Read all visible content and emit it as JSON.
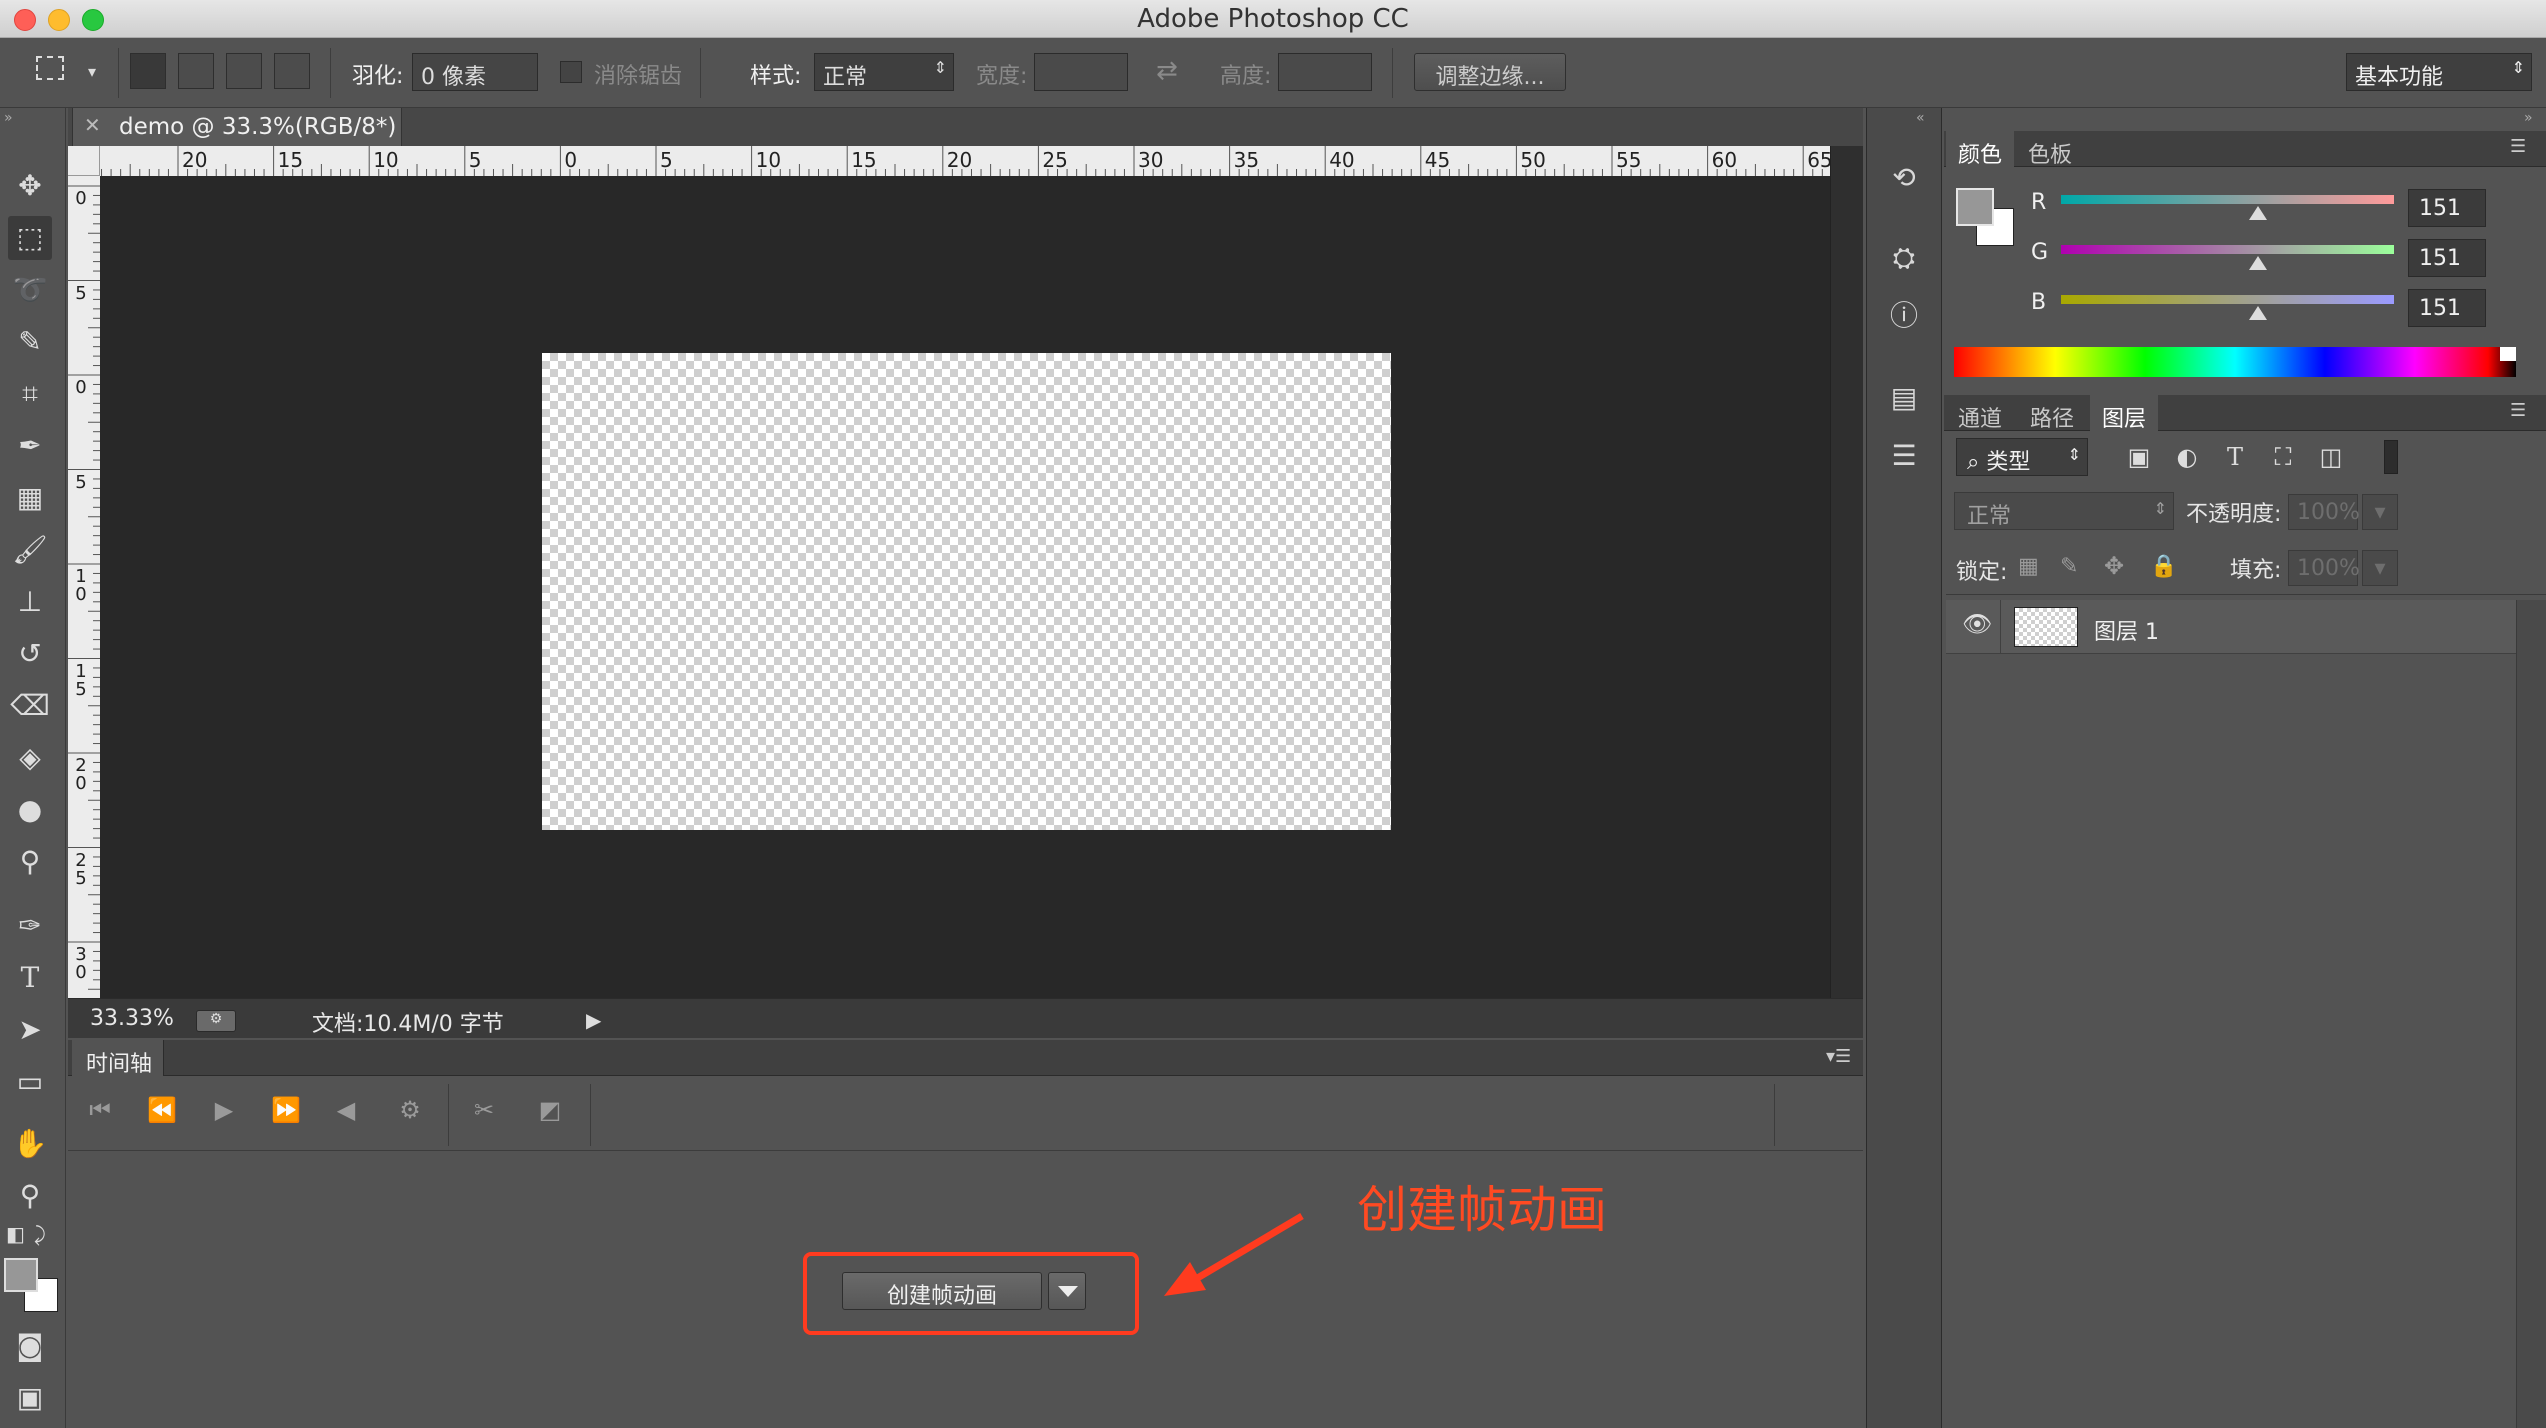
{
  "window": {
    "title": "Adobe Photoshop CC"
  },
  "options_bar": {
    "feather_label": "羽化:",
    "feather_value": "0 像素",
    "antialias_label": "消除锯齿",
    "style_label": "样式:",
    "style_value": "正常",
    "width_label": "宽度:",
    "height_label": "高度:",
    "refine_edge_button": "调整边缘...",
    "workspace_value": "基本功能"
  },
  "document": {
    "tab_title": "demo @ 33.3%(RGB/8*)",
    "hruler_labels": [
      "20",
      "15",
      "10",
      "5",
      "0",
      "5",
      "10",
      "15",
      "20",
      "25",
      "30",
      "35",
      "40",
      "45",
      "50",
      "55",
      "60",
      "65"
    ],
    "vruler_labels": [
      "0",
      "5",
      "0",
      "5",
      "1\n0",
      "1\n5",
      "2\n0",
      "2\n5",
      "3\n0"
    ],
    "zoom": "33.33%",
    "doc_info": "文档:10.4M/0 字节"
  },
  "timeline": {
    "tab_label": "时间轴",
    "create_button": "创建帧动画"
  },
  "annotation": {
    "text": "创建帧动画",
    "color": "#ff4a22"
  },
  "color_panel": {
    "tabs": [
      "颜色",
      "色板"
    ],
    "r_label": "R",
    "g_label": "G",
    "b_label": "B",
    "r_value": "151",
    "g_value": "151",
    "b_value": "151"
  },
  "layers_panel": {
    "tabs": [
      "通道",
      "路径",
      "图层"
    ],
    "filter_label": "类型",
    "blend_mode": "正常",
    "opacity_label": "不透明度:",
    "opacity_value": "100%",
    "lock_label": "锁定:",
    "fill_label": "填充:",
    "fill_value": "100%",
    "layer_name": "图层 1"
  }
}
